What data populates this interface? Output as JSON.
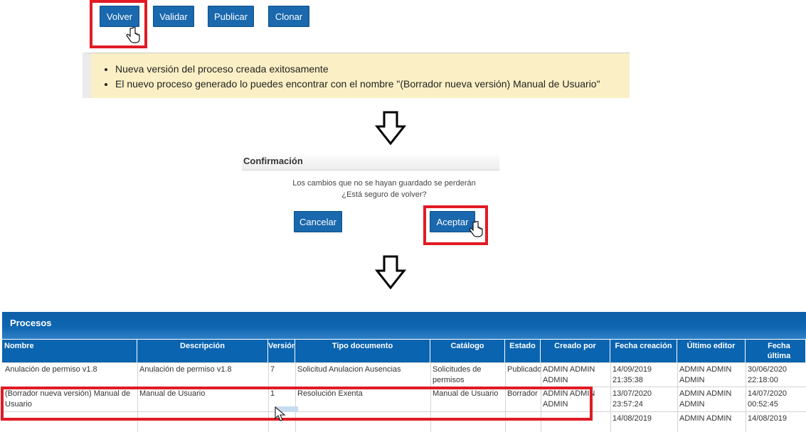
{
  "toolbar": {
    "buttons": [
      "Volver",
      "Validar",
      "Publicar",
      "Clonar"
    ]
  },
  "message": {
    "items": [
      "Nueva versión del proceso creada exitosamente",
      "El nuevo proceso generado lo puedes encontrar con el nombre \"(Borrador nueva versión) Manual de Usuario\""
    ]
  },
  "dialog": {
    "title": "Confirmación",
    "line1": "Los cambios que no se hayan guardado se perderán",
    "line2": "¿Está seguro de volver?",
    "cancel_label": "Cancelar",
    "accept_label": "Aceptar"
  },
  "grid": {
    "title": "Procesos",
    "columns": [
      "Nombre",
      "Descripción",
      "Versión",
      "Tipo documento",
      "Catálogo",
      "Estado",
      "Creado por",
      "Fecha creación",
      "Último editor",
      "Fecha última edición"
    ],
    "rows": [
      [
        "Anulación de permiso v1.8",
        "Anulación de permiso v1.8",
        "7",
        "Solicitud Anulacion Ausencias",
        "Solicitudes de permisos",
        "Publicado",
        "ADMIN ADMIN ADMIN",
        "14/09/2019 21:35:38",
        "ADMIN ADMIN ADMIN",
        "30/06/2020 22:18:00"
      ],
      [
        "(Borrador nueva versión) Manual de Usuario",
        "Manual de Usuario",
        "1",
        "Resolución Exenta",
        "Manual de Usuario",
        "Borrador",
        "ADMIN ADMIN ADMIN",
        "13/07/2020 23:57:24",
        "ADMIN ADMIN ADMIN",
        "14/07/2020 00:52:45"
      ],
      [
        "",
        "",
        "",
        "",
        "",
        "",
        "",
        "14/08/2019",
        "ADMIN ADMIN",
        "14/08/2019"
      ]
    ]
  },
  "colors": {
    "button_blue": "#1a68ad",
    "highlight_red": "#e01b24",
    "message_bg": "#fbf0c5",
    "header_blue": "#0a64b0"
  },
  "icons": {
    "cursor": "hand-pointer-icon",
    "arrow": "arrow-down-icon"
  }
}
